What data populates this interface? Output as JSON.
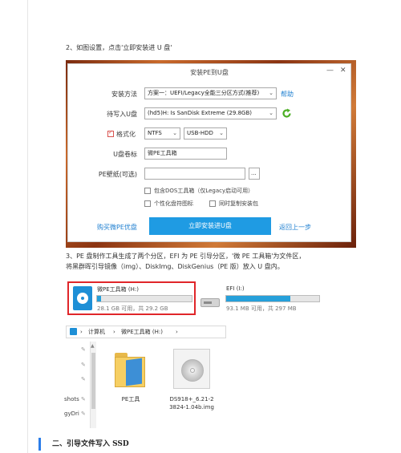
{
  "step2": "2、如图设置，点击'立即安装进 U 盘'",
  "window": {
    "title": "安装PE到U盘",
    "minimize": "—",
    "close": "✕",
    "install_method_label": "安装方法",
    "install_method_value": "方案一：UEFI/Legacy全能三分区方式(推荐)",
    "help": "帮助",
    "target_label": "待写入U盘",
    "target_value": "(hd5)H: Is SanDisk Extreme (29.8GB)",
    "format_label": "格式化",
    "fs_value": "NTFS",
    "mode_value": "USB-HDD",
    "volume_label": "U盘卷标",
    "volume_value": "微PE工具箱",
    "wallpaper_label": "PE壁纸(可选)",
    "wallpaper_value": "",
    "browse": "...",
    "opt_dos": "包含DOS工具箱（仅Legacy启动可用）",
    "opt_icon": "个性化盘符图标",
    "opt_copy": "同时复制安装包",
    "buy_link": "购买微PE优盘",
    "install_button": "立即安装进U盘",
    "back_link": "返回上一步"
  },
  "step3_line1": "3、PE 盘制作工具生成了两个分区，EFI 为 PE 引导分区，'微 PE 工具箱'为文件区，",
  "step3_line2": "将黑群晖引导镜像（img）、DiskImg、DiskGenius（PE 版）放入 U 盘内。",
  "drives": [
    {
      "name": "微PE工具箱 (H:)",
      "size": "28.1 GB 可用，共 29.2 GB",
      "used_percent": 4
    },
    {
      "name": "EFI (I:)",
      "size": "93.1 MB 可用，共 297 MB",
      "used_percent": 69
    }
  ],
  "explorer": {
    "path_sep1": "›",
    "path_computer": "计算机",
    "path_sep2": "›",
    "path_drive": "微PE工具箱 (H:)",
    "path_sep3": "›",
    "side_items": [
      "shots",
      "gyDri"
    ],
    "files": [
      {
        "name": "PE工具"
      },
      {
        "name_line1": "DS918+_6.21-2",
        "name_line2": "3824-1.04b.img"
      }
    ]
  },
  "section_heading": "二、引导文件写入 SSD"
}
